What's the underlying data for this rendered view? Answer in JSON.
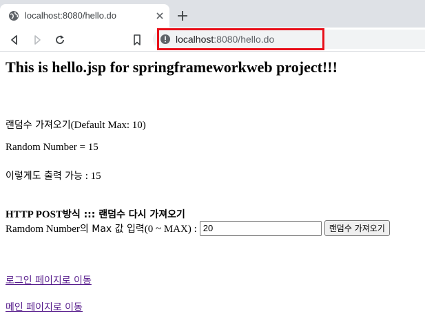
{
  "browser": {
    "tab_title": "localhost:8080/hello.do",
    "url_host": "localhost",
    "url_rest": ":8080/hello.do",
    "highlight_color": "#e8101a"
  },
  "page": {
    "heading": "This is hello.jsp for springframeworkweb project!!!",
    "random_caption_ko": "랜덤수 가져오기",
    "random_caption_en": "(Default Max: 10)",
    "random_number_line": "Random Number = 15",
    "print_line_ko": "이렇게도 출력 가능",
    "print_line_value": " : 15",
    "post_heading_en": "HTTP POST",
    "post_heading_ko": "방식 ::: 랜덤수 다시 가져오기",
    "form": {
      "label_part1": "Ramdom Number",
      "label_part2": "의 Max 값 입력",
      "label_part3": "(0 ~ MAX) : ",
      "input_value": "20",
      "submit_label": "랜덤수 가져오기"
    },
    "links": {
      "login": "로그인 페이지로 이동",
      "main": "메인 페이지로 이동"
    },
    "link_color": "#551a8b"
  }
}
